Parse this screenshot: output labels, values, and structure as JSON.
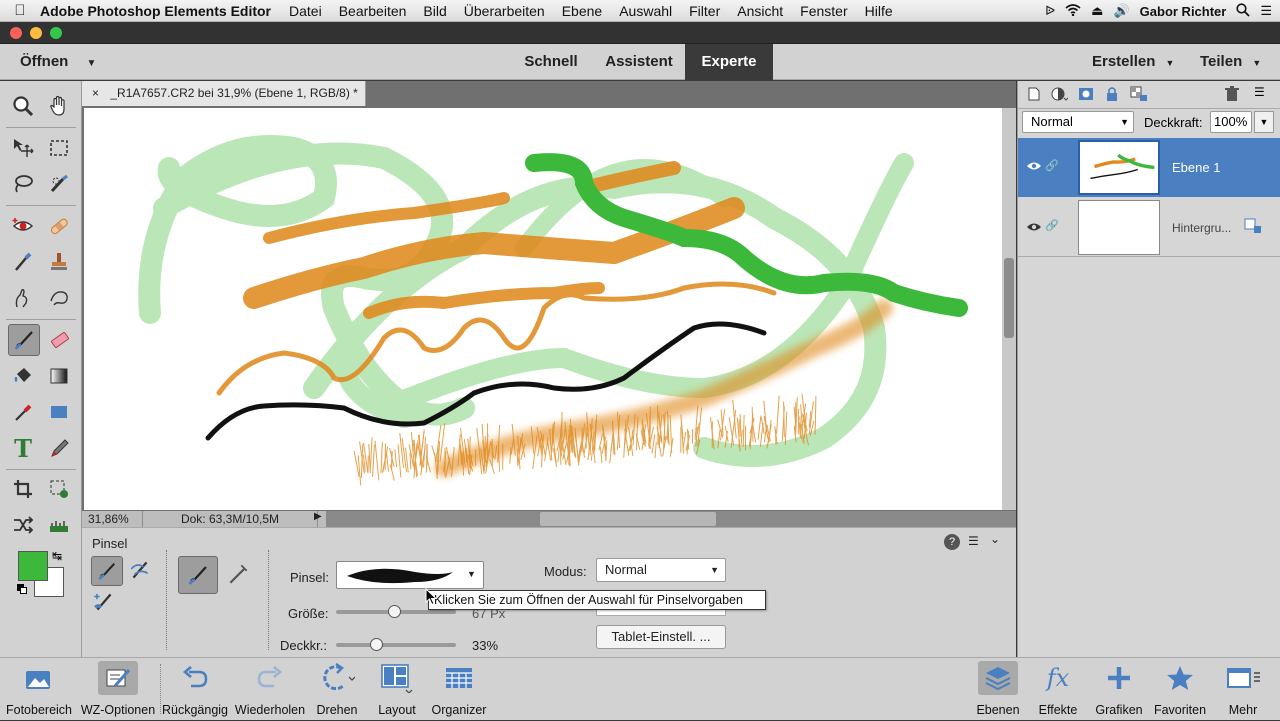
{
  "menubar": {
    "app_name": "Adobe Photoshop Elements Editor",
    "items": [
      "Datei",
      "Bearbeiten",
      "Bild",
      "Überarbeiten",
      "Ebene",
      "Auswahl",
      "Filter",
      "Ansicht",
      "Fenster",
      "Hilfe"
    ],
    "user": "Gabor Richter"
  },
  "modebar": {
    "open_label": "Öffnen",
    "tabs": [
      "Schnell",
      "Assistent",
      "Experte"
    ],
    "active_tab": "Experte",
    "create_label": "Erstellen",
    "share_label": "Teilen"
  },
  "document": {
    "tab_title": "_R1A7657.CR2 bei 31,9% (Ebene 1, RGB/8) *",
    "zoom": "31,86%",
    "doc_info": "Dok: 63,3M/10,5M"
  },
  "options": {
    "tool_name": "Pinsel",
    "brush_label": "Pinsel:",
    "size_label": "Größe:",
    "size_value": "67 Px",
    "opacity_label": "Deckkr.:",
    "opacity_value": "33%",
    "mode_label": "Modus:",
    "mode_value": "Normal",
    "tablet_button": "Tablet-Einstell. ...",
    "tooltip": "Klicken Sie zum Öffnen der Auswahl für Pinselvorgaben",
    "size_fraction": 0.48,
    "opacity_fraction": 0.33
  },
  "layers": {
    "blend_mode": "Normal",
    "opacity_label": "Deckkraft:",
    "opacity_value": "100%",
    "items": [
      {
        "name": "Ebene 1"
      },
      {
        "name": "Hintergru..."
      }
    ]
  },
  "bottombar": {
    "left": [
      "Fotobereich",
      "WZ-Optionen",
      "Rückgängig",
      "Wiederholen",
      "Drehen",
      "Layout",
      "Organizer"
    ],
    "right": [
      "Ebenen",
      "Effekte",
      "Grafiken",
      "Favoriten",
      "Mehr"
    ]
  },
  "colors": {
    "foreground": "#3cb83a",
    "background": "#ffffff",
    "accent": "#4a7fc1",
    "orange": "#e08a1e",
    "light_green": "#8fd68a"
  }
}
